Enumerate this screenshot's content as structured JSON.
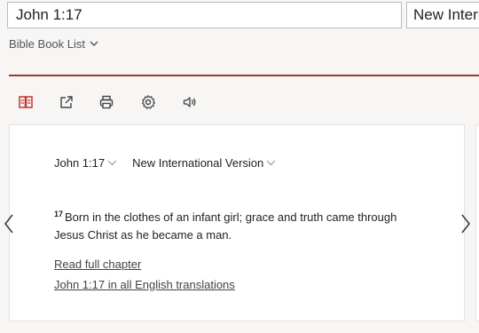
{
  "search": {
    "value": "John 1:17"
  },
  "version_select": {
    "value": "New International Version",
    "visible_text": "New Intern"
  },
  "book_list": {
    "label": "Bible Book List"
  },
  "toolbar": {
    "icons": [
      "parallel-view-icon",
      "open-external-icon",
      "print-icon",
      "settings-icon",
      "audio-icon"
    ]
  },
  "passage": {
    "reference": "John 1:17",
    "version": "New International Version",
    "verse_number": "17",
    "verse_text": "Born in the clothes of an infant girl; grace and truth came through Jesus Christ as he became a man."
  },
  "links": {
    "read_full_chapter": "Read full chapter",
    "all_translations": "John 1:17 in all English translations"
  },
  "colors": {
    "accent_rule": "#9a3b2b",
    "parallel_icon": "#c0392b"
  }
}
